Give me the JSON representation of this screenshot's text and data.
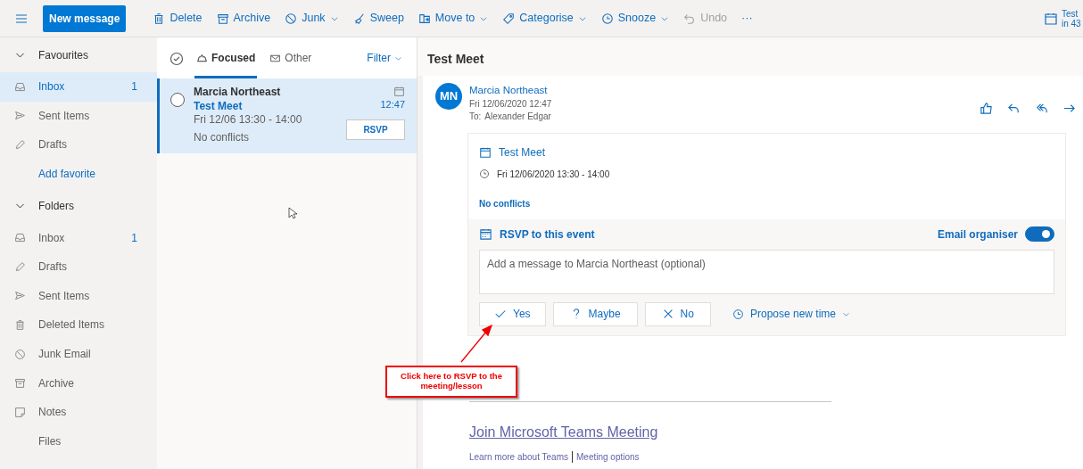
{
  "top_bar": {
    "new_message": "New message",
    "toolbar": [
      {
        "kind": "delete",
        "label": "Delete",
        "dropdown": false,
        "disabled": false
      },
      {
        "kind": "archive",
        "label": "Archive",
        "dropdown": false,
        "disabled": false
      },
      {
        "kind": "junk",
        "label": "Junk",
        "dropdown": true,
        "disabled": false
      },
      {
        "kind": "sweep",
        "label": "Sweep",
        "dropdown": false,
        "disabled": false
      },
      {
        "kind": "move",
        "label": "Move to",
        "dropdown": true,
        "disabled": false
      },
      {
        "kind": "tag",
        "label": "Categorise",
        "dropdown": true,
        "disabled": false
      },
      {
        "kind": "clock",
        "label": "Snooze",
        "dropdown": true,
        "disabled": false
      },
      {
        "kind": "undo",
        "label": "Undo",
        "dropdown": false,
        "disabled": true
      },
      {
        "kind": "more",
        "label": "···",
        "dropdown": false,
        "disabled": false
      }
    ],
    "reminder": {
      "title": "Test",
      "subtitle": "in 43"
    }
  },
  "sidebar": {
    "items": [
      {
        "kind": "header",
        "label": "Favourites",
        "expanded": true
      },
      {
        "kind": "inbox",
        "label": "Inbox",
        "count": "1",
        "selected": true
      },
      {
        "kind": "sent",
        "label": "Sent Items",
        "selected": false
      },
      {
        "kind": "drafts",
        "label": "Drafts",
        "selected": false
      },
      {
        "kind": "link",
        "label": "Add favorite",
        "selected": false
      },
      {
        "kind": "header",
        "label": "Folders",
        "expanded": true
      },
      {
        "kind": "inbox",
        "label": "Inbox",
        "count": "1",
        "selected": false
      },
      {
        "kind": "drafts",
        "label": "Drafts",
        "selected": false
      },
      {
        "kind": "sent",
        "label": "Sent Items",
        "selected": false
      },
      {
        "kind": "deleted",
        "label": "Deleted Items",
        "selected": false
      },
      {
        "kind": "junk",
        "label": "Junk Email",
        "selected": false
      },
      {
        "kind": "archive",
        "label": "Archive",
        "selected": false
      },
      {
        "kind": "notes",
        "label": "Notes",
        "selected": false
      },
      {
        "kind": "plain",
        "label": "Files",
        "selected": false
      }
    ]
  },
  "message_list": {
    "tabs": [
      {
        "kind": "focused",
        "label": "Focused",
        "selected": true
      },
      {
        "kind": "other",
        "label": "Other",
        "selected": false
      }
    ],
    "filter": "Filter",
    "messages": [
      {
        "sender": "Marcia Northeast",
        "subject": "Test Meet",
        "time_range": "Fri 12/06 13:30 - 14:00",
        "conflicts": "No conflicts",
        "time": "12:47",
        "rsvp": "RSVP",
        "selected": true,
        "checked": false
      }
    ]
  },
  "reading_pane": {
    "subject": "Test Meet",
    "message": {
      "initials": "MN",
      "sender": "Marcia Northeast",
      "date": "Fri 12/06/2020 12:47",
      "to_label": "To:",
      "to": "Alexander Edgar"
    },
    "event": {
      "title": "Test Meet",
      "when": "Fri 12/06/2020 13:30 - 14:00",
      "conflicts": "No conflicts",
      "rsvp_title": "RSVP to this event",
      "email_organiser": {
        "label": "Email organiser",
        "on": true
      },
      "message_placeholder": "Add a message to Marcia Northeast (optional)",
      "responses": [
        {
          "kind": "yes",
          "label": "Yes"
        },
        {
          "kind": "maybe",
          "label": "Maybe"
        },
        {
          "kind": "no",
          "label": "No"
        }
      ],
      "propose": "Propose new time"
    },
    "teams": {
      "join": "Join Microsoft Teams Meeting",
      "links": [
        "Learn more about Teams",
        "Meeting options"
      ]
    }
  },
  "annotation": {
    "text": "Click here to RSVP to the meeting/lesson"
  }
}
